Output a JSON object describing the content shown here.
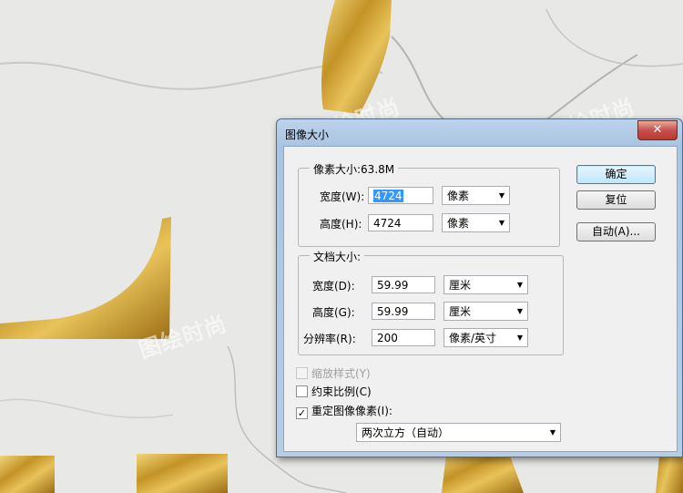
{
  "background": {
    "watermark_text": "图绘时尚"
  },
  "dialog": {
    "title": "图像大小",
    "close_glyph": "✕",
    "pixel_group": {
      "title": "像素大小:63.8M",
      "width_label": "宽度(W):",
      "width_value": "4724",
      "width_unit": "像素",
      "height_label": "高度(H):",
      "height_value": "4724",
      "height_unit": "像素"
    },
    "doc_group": {
      "title": "文档大小:",
      "width_label": "宽度(D):",
      "width_value": "59.99",
      "width_unit": "厘米",
      "height_label": "高度(G):",
      "height_value": "59.99",
      "height_unit": "厘米",
      "res_label": "分辨率(R):",
      "res_value": "200",
      "res_unit": "像素/英寸"
    },
    "checkboxes": {
      "scale_styles": {
        "label": "缩放样式(Y)",
        "checked": false,
        "enabled": false
      },
      "constrain": {
        "label": "约束比例(C)",
        "checked": false,
        "enabled": true
      },
      "resample": {
        "label": "重定图像像素(I):",
        "checked": true,
        "enabled": true
      }
    },
    "resample_method": "两次立方（自动）",
    "buttons": {
      "ok": "确定",
      "reset": "复位",
      "auto": "自动(A)..."
    }
  },
  "colors": {
    "gold": "#c99a2e",
    "selection": "#3399ff",
    "close_red": "#c75050"
  }
}
